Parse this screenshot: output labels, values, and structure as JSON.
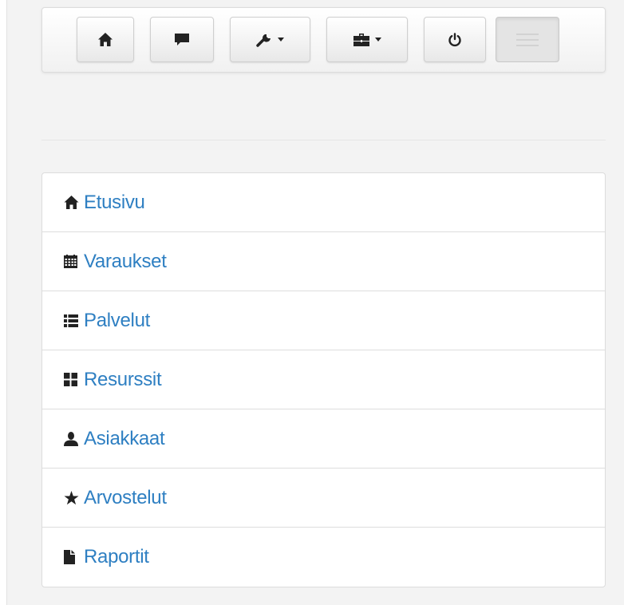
{
  "toolbar": {
    "buttons": [
      {
        "icon": "home-icon"
      },
      {
        "icon": "comment-icon"
      },
      {
        "icon": "wrench-icon",
        "dropdown": true
      },
      {
        "icon": "briefcase-icon",
        "dropdown": true
      },
      {
        "icon": "power-icon"
      },
      {
        "icon": "menu-icon",
        "state": "active"
      }
    ]
  },
  "menu": {
    "items": [
      {
        "label": "Etusivu",
        "icon": "home-icon"
      },
      {
        "label": "Varaukset",
        "icon": "calendar-icon"
      },
      {
        "label": "Palvelut",
        "icon": "list-icon"
      },
      {
        "label": "Resurssit",
        "icon": "th-large-icon"
      },
      {
        "label": "Asiakkaat",
        "icon": "user-icon"
      },
      {
        "label": "Arvostelut",
        "icon": "star-icon"
      },
      {
        "label": "Raportit",
        "icon": "file-icon"
      }
    ]
  },
  "colors": {
    "link": "#2e7fc2",
    "icon": "#222222",
    "background": "#f3f3f3"
  }
}
